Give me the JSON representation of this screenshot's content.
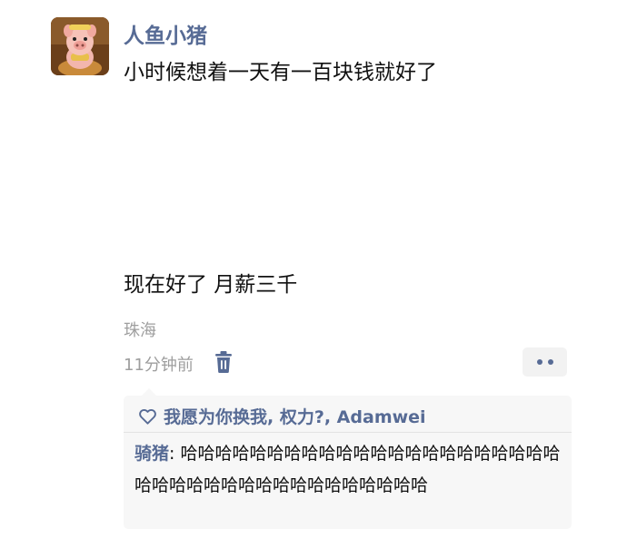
{
  "post": {
    "author": "人鱼小猪",
    "avatar_icon": "pig-avatar-icon",
    "text_line_1": "小时候想着一天有一百块钱就好了",
    "text_line_2": "现在好了 月薪三千",
    "location": "珠海",
    "time": "11分钟前"
  },
  "actions": {
    "delete_icon": "trash-icon",
    "more_icon": "more-dots-icon"
  },
  "likes": {
    "icon": "heart-icon",
    "text": "我愿为你换我, 权力?, Adamwei"
  },
  "comments": [
    {
      "author": "骑猪",
      "separator": ": ",
      "text": "哈哈哈哈哈哈哈哈哈哈哈哈哈哈哈哈哈哈哈哈哈哈哈哈哈哈哈哈哈哈哈哈哈哈哈哈哈哈哈"
    }
  ],
  "colors": {
    "link": "#576b95",
    "meta": "#9e9e9e",
    "panel_bg": "#f7f7f7",
    "more_bg": "#f2f2f2"
  }
}
